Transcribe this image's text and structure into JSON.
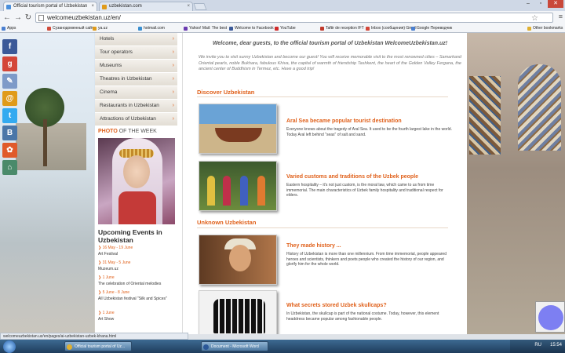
{
  "browser": {
    "tabs": [
      {
        "label": "Official tourism portal of Uzbekistan",
        "active": true
      },
      {
        "label": "uzbekistan.com",
        "active": false
      }
    ],
    "url": "welcomeuzbekistan.uz/en/",
    "bookmarks": [
      {
        "label": "Apps",
        "color": "#4a7fd0"
      },
      {
        "label": "Cyзанодоменный сайт",
        "color": "#d04a3a"
      },
      {
        "label": "ya.uz",
        "color": "#e09b1a"
      },
      {
        "label": "hotmail.com",
        "color": "#3a8fd0"
      },
      {
        "label": "Yahoo! Mail: The best",
        "color": "#6a3ab0"
      },
      {
        "label": "Welcome to Facebook",
        "color": "#3b5998"
      },
      {
        "label": "YouTube",
        "color": "#d02a2a"
      },
      {
        "label": "Taftir de reception IFT",
        "color": "#c0392b"
      },
      {
        "label": "Inbox (сообщения) Gmail",
        "color": "#d44638"
      },
      {
        "label": "Google Переводчик",
        "color": "#4a7fd0"
      },
      {
        "label": "Other bookmarks",
        "color": "#e0b030"
      }
    ]
  },
  "social": [
    {
      "glyph": "f",
      "color": "#3b5998"
    },
    {
      "glyph": "g",
      "color": "#d44638"
    },
    {
      "glyph": "✎",
      "color": "#7d9ac8"
    },
    {
      "glyph": "@",
      "color": "#e09b1a"
    },
    {
      "glyph": "t",
      "color": "#33aaf0"
    },
    {
      "glyph": "B",
      "color": "#4a76a8"
    },
    {
      "glyph": "✿",
      "color": "#e05a2a"
    },
    {
      "glyph": "⌂",
      "color": "#4a8a6a"
    }
  ],
  "menu": [
    {
      "label": "Hotels"
    },
    {
      "label": "Tour operators"
    },
    {
      "label": "Museums"
    },
    {
      "label": "Theatres in Uzbekistan"
    },
    {
      "label": "Cinema"
    },
    {
      "label": "Restaurants in Uzbekistan"
    },
    {
      "label": "Attractions of Uzbekistan"
    }
  ],
  "photo_week": {
    "label_bold": "PHOTO",
    "label_rest": " OF THE WEEK"
  },
  "events": {
    "title": "Upcoming Events in Uzbekistan",
    "items": [
      {
        "date": "16 May - 19 June",
        "text": "Art Festival"
      },
      {
        "date": "31 May - 5 June",
        "text": "Muzeum.uz"
      },
      {
        "date": "1 June",
        "text": "The celebration of Oriental melodies"
      },
      {
        "date": "5 June - 8 June",
        "text": "All Uzbekistan festival \"Silk and Spices\""
      },
      {
        "date": "1 June",
        "text": "Art Show"
      }
    ]
  },
  "main": {
    "welcome": "Welcome, dear guests, to the official tourism portal of Uzbekistan WelcomeUzbekistan.uz!",
    "intro": "We invite you to visit sunny Uzbekistan and become our guest! You will receive memorable visit to the most renowned cities – Samarkand Oriental pearls, noble Bukhara, fabulous Khiva, the capital of warmth of friendship Tashkent, the heart of the Golden Valley Fergana, the ancient center of Buddhism in Termez, etc. Have a good trip!",
    "discover_title": "Discover Uzbekistan",
    "unknown_title": "Unknown Uzbekistan",
    "articles": [
      {
        "title": "Aral Sea became popular tourist destination",
        "text": "Everyone knows about the tragedy of Aral Sea. It used to be the fourth largest lake in the world. Today Aral left behind \"seas\" of salt and sand."
      },
      {
        "title": "Varied customs and traditions of the Uzbek people",
        "text": "Eastern hospitality – it's not just custom, is the moral law, which came to us from time immemorial. The main characteristics of Uzbek family hospitality and traditional respect for elders."
      },
      {
        "title": "They made history ...",
        "text": "History of Uzbekistan is more than one millennium. From time immemorial, people appeared heroes and scientists, thinkers and poets people who created the history of our region, and glorify him for the whole world."
      },
      {
        "title": "What secrets stored Uzbek skullcaps?",
        "text": "In Uzbekistan, the skullcap is part of the national costume. Today, however, this element headdress became popular among fashionable people."
      }
    ]
  },
  "status_url": "welcomeuzbekistan.uz/en/pages/ai-uzbekistan-uzbek-khana.html",
  "taskbar": {
    "items": [
      {
        "label": "Official tourism portal of Uz...",
        "color": "#e0b030"
      },
      {
        "label": "Document - Microsoft Word",
        "color": "#2b5797"
      }
    ],
    "lang": "RU",
    "clock": "15:54"
  }
}
